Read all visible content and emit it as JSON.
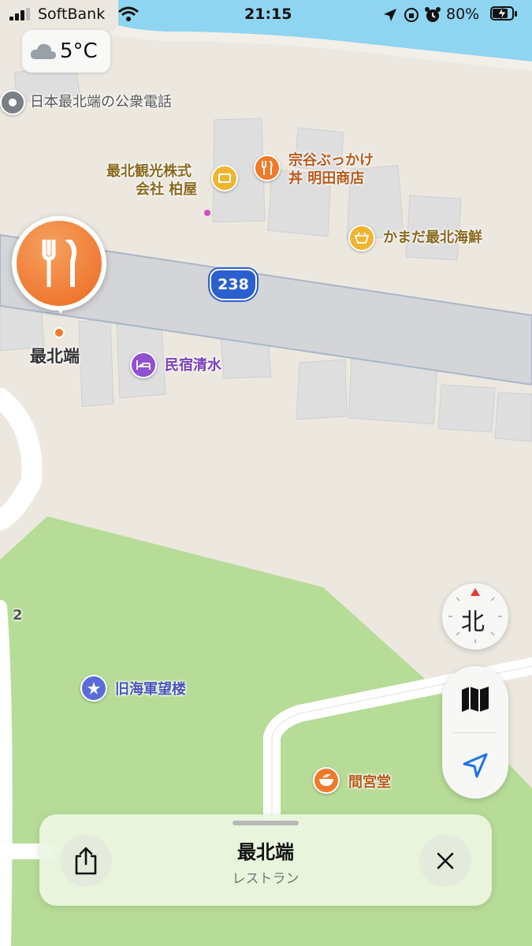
{
  "status": {
    "carrier": "SoftBank",
    "time": "21:15",
    "battery": "80%",
    "icons": [
      "signal-bars-icon",
      "wifi-icon",
      "location-arrow-icon",
      "orientation-lock-icon",
      "alarm-icon",
      "battery-charging-icon"
    ]
  },
  "weather": {
    "temp": "5°C",
    "icon": "cloud-icon"
  },
  "map": {
    "route_number": "238",
    "labels": {
      "payphone": "日本最北端の公衆電話",
      "souvenir_line1": "最北観光株式",
      "souvenir_line2": "会社 柏屋",
      "restaurant_line1": "宗谷ぶっかけ",
      "restaurant_line2": "丼 明田商店",
      "seafood": "かまだ最北海鮮",
      "selected_pin": "最北端",
      "inn": "民宿清水",
      "lookout": "旧海軍望楼",
      "mamiyado": "間宮堂",
      "road_number_left": "2"
    },
    "colors": {
      "water": "#8fd4f0",
      "land": "#ece8e0",
      "park": "#b7dc98",
      "road": "#d7d8db",
      "pin": "#f07a2a",
      "food": "#f07a2a",
      "shop": "#f0b530",
      "hotel": "#9050d0",
      "landmark": "#5a6bd8"
    }
  },
  "controls": {
    "compass_label": "北",
    "map_mode_icon": "map-icon",
    "locate_icon": "location-arrow-icon"
  },
  "sheet": {
    "title": "最北端",
    "subtitle": "レストラン",
    "share_icon": "share-icon",
    "close_icon": "close-icon"
  }
}
